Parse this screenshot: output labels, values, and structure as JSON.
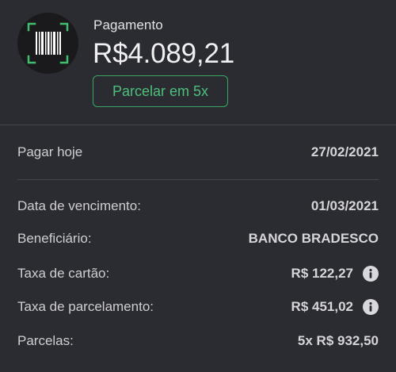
{
  "header": {
    "title": "Pagamento",
    "amount": "R$4.089,21",
    "installment_button": "Parcelar em 5x",
    "icon": "barcode-scan-icon",
    "accent_color": "#3aa664"
  },
  "pay_today": {
    "label": "Pagar hoje",
    "value": "27/02/2021"
  },
  "details": [
    {
      "label": "Data de vencimento:",
      "value": "01/03/2021"
    },
    {
      "label": "Beneficiário:",
      "value": "BANCO BRADESCO"
    },
    {
      "label": "Taxa de cartão:",
      "value": "R$ 122,27",
      "icon": "info-icon"
    },
    {
      "label": "Taxa de parcelamento:",
      "value": "R$ 451,02",
      "icon": "info-icon"
    },
    {
      "label": "Parcelas:",
      "value": "5x R$ 932,50"
    }
  ]
}
